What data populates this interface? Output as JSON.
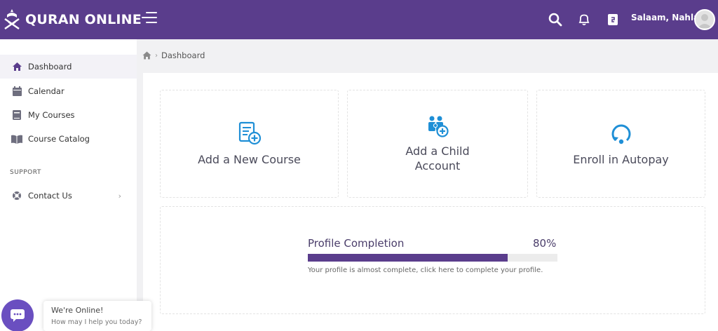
{
  "header": {
    "brand": "QURAN ONLINE",
    "greeting": "Salaam,  Nahla",
    "accent_color": "#5a3d8c",
    "icons": [
      "menu-icon",
      "search-icon",
      "bell-icon",
      "document-icon",
      "avatar"
    ]
  },
  "sidebar": {
    "items": [
      {
        "label": "Dashboard",
        "icon": "home-icon"
      },
      {
        "label": "Calendar",
        "icon": "calendar-icon"
      },
      {
        "label": "My Courses",
        "icon": "book-icon"
      },
      {
        "label": "Course Catalog",
        "icon": "open-book-icon"
      }
    ],
    "support_label": "SUPPORT",
    "support_items": [
      {
        "label": "Contact Us",
        "icon": "lifebuoy-icon"
      }
    ]
  },
  "breadcrumb": {
    "current": "Dashboard"
  },
  "cards": [
    {
      "label": "Add a New Course",
      "icon": "add-course-icon"
    },
    {
      "label": "Add a Child Account",
      "icon": "add-child-icon"
    },
    {
      "label": "Enroll in Autopay",
      "icon": "autopay-icon"
    }
  ],
  "profile": {
    "title": "Profile Completion",
    "percent_label": "80%",
    "percent": 80,
    "note": "Your profile is almost complete, click here to complete your profile."
  },
  "chat": {
    "title": "We're Online!",
    "subtitle": "How may I help you today?"
  }
}
